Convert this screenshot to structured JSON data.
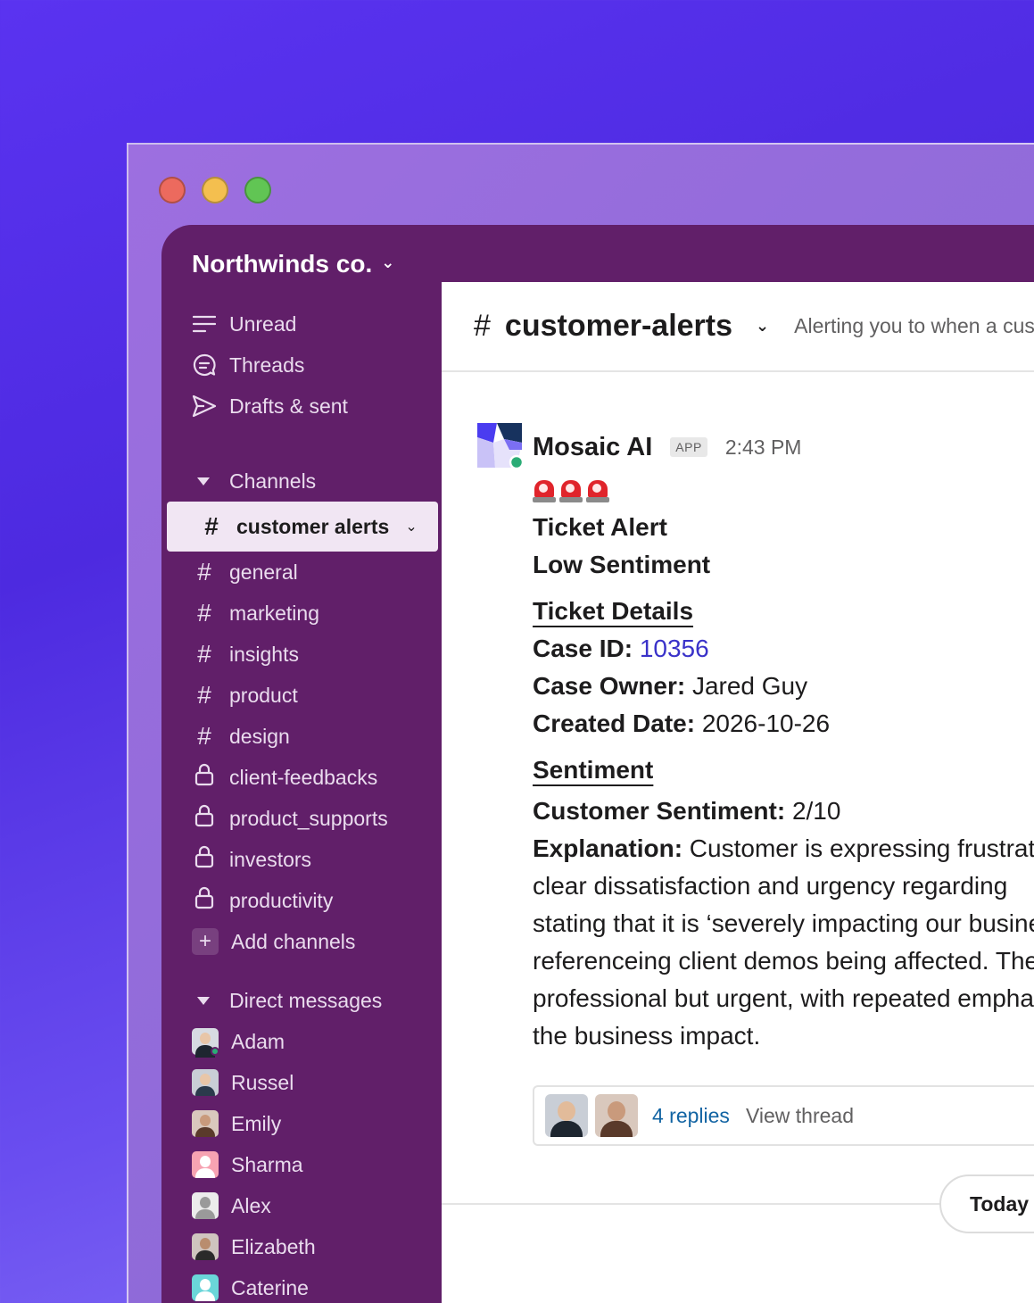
{
  "window": {
    "controls": [
      "close",
      "minimize",
      "zoom"
    ]
  },
  "workspace": {
    "name": "Northwinds co.",
    "chevron_icon": "chevron-down-icon"
  },
  "sidebar": {
    "nav": [
      {
        "label": "Unread",
        "icon": "unread-lines-icon"
      },
      {
        "label": "Threads",
        "icon": "threads-icon"
      },
      {
        "label": "Drafts & sent",
        "icon": "send-icon"
      }
    ],
    "channels_header": "Channels",
    "channels": [
      {
        "label": "customer alerts",
        "type": "public",
        "active": true
      },
      {
        "label": "general",
        "type": "public"
      },
      {
        "label": "marketing",
        "type": "public"
      },
      {
        "label": "insights",
        "type": "public"
      },
      {
        "label": "product",
        "type": "public"
      },
      {
        "label": "design",
        "type": "public"
      },
      {
        "label": "client-feedbacks",
        "type": "private"
      },
      {
        "label": "product_supports",
        "type": "private"
      },
      {
        "label": "investors",
        "type": "private"
      },
      {
        "label": "productivity",
        "type": "private"
      }
    ],
    "add_channels": "Add channels",
    "dm_header": "Direct messages",
    "dms": [
      {
        "name": "Adam",
        "bg": "#d7dbe2",
        "shirt": "#1e2630",
        "online": true
      },
      {
        "name": "Russel",
        "bg": "#c9ced6",
        "shirt": "#2b3a4c",
        "online": false
      },
      {
        "name": "Emily",
        "bg": "#d9c8bd",
        "shirt": "#5a3a2b",
        "online": false
      },
      {
        "name": "Sharma",
        "bg": "#f7a3b2",
        "shirt": "#ffffff",
        "online": false
      },
      {
        "name": "Alex",
        "bg": "#e3e3e3",
        "shirt": "#9a9a9a",
        "online": false
      },
      {
        "name": "Elizabeth",
        "bg": "#cfc5bf",
        "shirt": "#2a2a2a",
        "online": false
      },
      {
        "name": "Caterine",
        "bg": "#6ad6d9",
        "shirt": "#ffffff",
        "online": false
      }
    ]
  },
  "channel": {
    "hash": "#",
    "name": "customer-alerts",
    "topic": "Alerting you to when a customer has low sentiment"
  },
  "message": {
    "sender": "Mosaic AI",
    "badge": "APP",
    "time": "2:43 PM",
    "siren_count": 3,
    "title1": "Ticket Alert",
    "title2": "Low Sentiment",
    "details_heading": "Ticket Details",
    "case_id_label": "Case ID:",
    "case_id": "10356",
    "owner_label": "Case Owner:",
    "owner": "Jared Guy",
    "created_label": "Created Date:",
    "created": "2026-10-26",
    "sentiment_heading": "Sentiment",
    "score_label": "Customer Sentiment:",
    "score": "2/10",
    "explanation_label": "Explanation:",
    "explanation_lines": [
      " Customer is expressing frustration",
      "clear dissatisfaction and urgency regarding",
      "stating that it is ‘severely impacting our business",
      "referenceing client demos being affected. The",
      "professional but urgent, with repeated emphasis on",
      "the business impact."
    ],
    "thread": {
      "replies": "4 replies",
      "view": "View thread"
    }
  },
  "date_divider": "Today",
  "colors": {
    "sidebar": "#611f69",
    "link": "#3a32c9",
    "replies": "#1264a3"
  }
}
